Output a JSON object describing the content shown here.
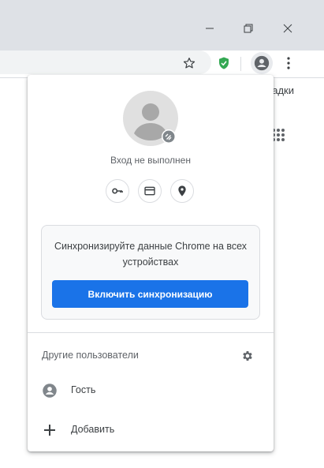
{
  "toolbar": {
    "bookmarks_fragment": "адки"
  },
  "profile_menu": {
    "status": "Вход не выполнен",
    "quick_icons": [
      "key-icon",
      "credit-card-icon",
      "location-pin-icon"
    ],
    "sync_promo": {
      "text": "Синхронизируйте данные Chrome на всех устройствах",
      "button_label": "Включить синхронизацию"
    },
    "other_users": {
      "title": "Другие пользователи",
      "items": [
        {
          "label": "Гость",
          "icon": "guest-avatar-icon"
        },
        {
          "label": "Добавить",
          "icon": "plus-icon"
        }
      ]
    }
  },
  "colors": {
    "accent": "#1a73e8",
    "titlebar": "#dee1e6",
    "shield": "#34a853"
  }
}
